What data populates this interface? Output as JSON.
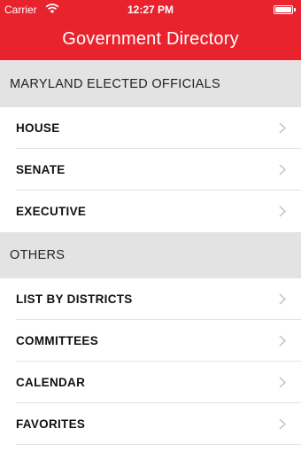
{
  "status_bar": {
    "carrier": "Carrier",
    "time": "12:27 PM",
    "wifi_icon": "wifi-icon",
    "battery_icon": "battery-full-icon"
  },
  "nav": {
    "title": "Government Directory"
  },
  "colors": {
    "accent": "#e8232e",
    "section_bg": "#e3e3e3"
  },
  "sections": [
    {
      "title": "MARYLAND ELECTED OFFICIALS",
      "items": [
        {
          "label": "HOUSE"
        },
        {
          "label": "SENATE"
        },
        {
          "label": "EXECUTIVE"
        }
      ]
    },
    {
      "title": "OTHERS",
      "items": [
        {
          "label": "LIST BY DISTRICTS"
        },
        {
          "label": "COMMITTEES"
        },
        {
          "label": "CALENDAR"
        },
        {
          "label": "FAVORITES"
        }
      ]
    }
  ]
}
